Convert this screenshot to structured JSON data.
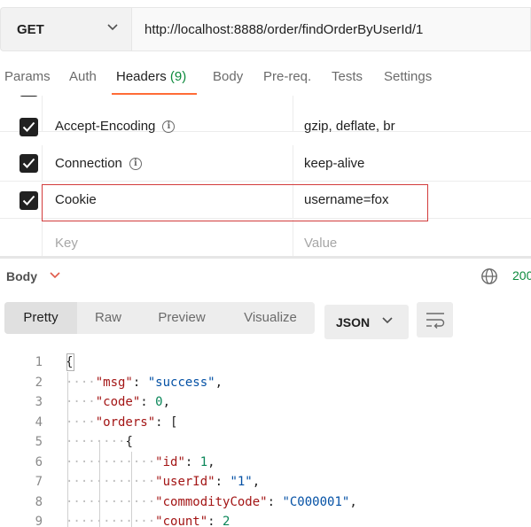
{
  "request": {
    "method": "GET",
    "url": "http://localhost:8888/order/findOrderByUserId/1"
  },
  "tabs": [
    {
      "label": "Params"
    },
    {
      "label": "Auth"
    },
    {
      "label": "Headers",
      "count": "(9)"
    },
    {
      "label": "Body"
    },
    {
      "label": "Pre-req."
    },
    {
      "label": "Tests"
    },
    {
      "label": "Settings"
    }
  ],
  "headers": {
    "rows": [
      {
        "key": "Accept-Encoding",
        "value": "gzip, deflate, br",
        "checked": true,
        "info": true
      },
      {
        "key": "Connection",
        "value": "keep-alive",
        "checked": true,
        "info": true
      },
      {
        "key": "Cookie",
        "value": "username=fox",
        "checked": true,
        "info": false
      }
    ],
    "new_row": {
      "key_placeholder": "Key",
      "value_placeholder": "Value"
    }
  },
  "response": {
    "section_label": "Body",
    "status": "200",
    "view_tabs": [
      "Pretty",
      "Raw",
      "Preview",
      "Visualize"
    ],
    "format": "JSON"
  },
  "code_lines": [
    {
      "n": "1",
      "dots": "",
      "tokens": [
        {
          "t": "{",
          "c": "p"
        }
      ]
    },
    {
      "n": "2",
      "dots": "····",
      "tokens": [
        {
          "t": "\"msg\"",
          "c": "k"
        },
        {
          "t": ": ",
          "c": "p"
        },
        {
          "t": "\"success\"",
          "c": "s"
        },
        {
          "t": ",",
          "c": "p"
        }
      ]
    },
    {
      "n": "3",
      "dots": "····",
      "tokens": [
        {
          "t": "\"code\"",
          "c": "k"
        },
        {
          "t": ": ",
          "c": "p"
        },
        {
          "t": "0",
          "c": "n"
        },
        {
          "t": ",",
          "c": "p"
        }
      ]
    },
    {
      "n": "4",
      "dots": "····",
      "tokens": [
        {
          "t": "\"orders\"",
          "c": "k"
        },
        {
          "t": ": [",
          "c": "p"
        }
      ]
    },
    {
      "n": "5",
      "dots": "········",
      "tokens": [
        {
          "t": "{",
          "c": "p"
        }
      ]
    },
    {
      "n": "6",
      "dots": "············",
      "tokens": [
        {
          "t": "\"id\"",
          "c": "k"
        },
        {
          "t": ": ",
          "c": "p"
        },
        {
          "t": "1",
          "c": "n"
        },
        {
          "t": ",",
          "c": "p"
        }
      ]
    },
    {
      "n": "7",
      "dots": "············",
      "tokens": [
        {
          "t": "\"userId\"",
          "c": "k"
        },
        {
          "t": ": ",
          "c": "p"
        },
        {
          "t": "\"1\"",
          "c": "s"
        },
        {
          "t": ",",
          "c": "p"
        }
      ]
    },
    {
      "n": "8",
      "dots": "············",
      "tokens": [
        {
          "t": "\"commodityCode\"",
          "c": "k"
        },
        {
          "t": ": ",
          "c": "p"
        },
        {
          "t": "\"C000001\"",
          "c": "s"
        },
        {
          "t": ",",
          "c": "p"
        }
      ]
    },
    {
      "n": "9",
      "dots": "············",
      "tokens": [
        {
          "t": "\"count\"",
          "c": "k"
        },
        {
          "t": ": ",
          "c": "p"
        },
        {
          "t": "2",
          "c": "n"
        }
      ]
    }
  ],
  "colors": {
    "accent": "#ff6c37",
    "status_green": "#0c8a3c",
    "highlight_border": "#d23c3c",
    "json_key": "#a31515",
    "json_string": "#0451a5",
    "json_number": "#098658"
  },
  "icons": [
    "chevron-down-icon",
    "info-icon",
    "checkbox-checked-icon",
    "globe-icon",
    "wrap-lines-icon"
  ]
}
